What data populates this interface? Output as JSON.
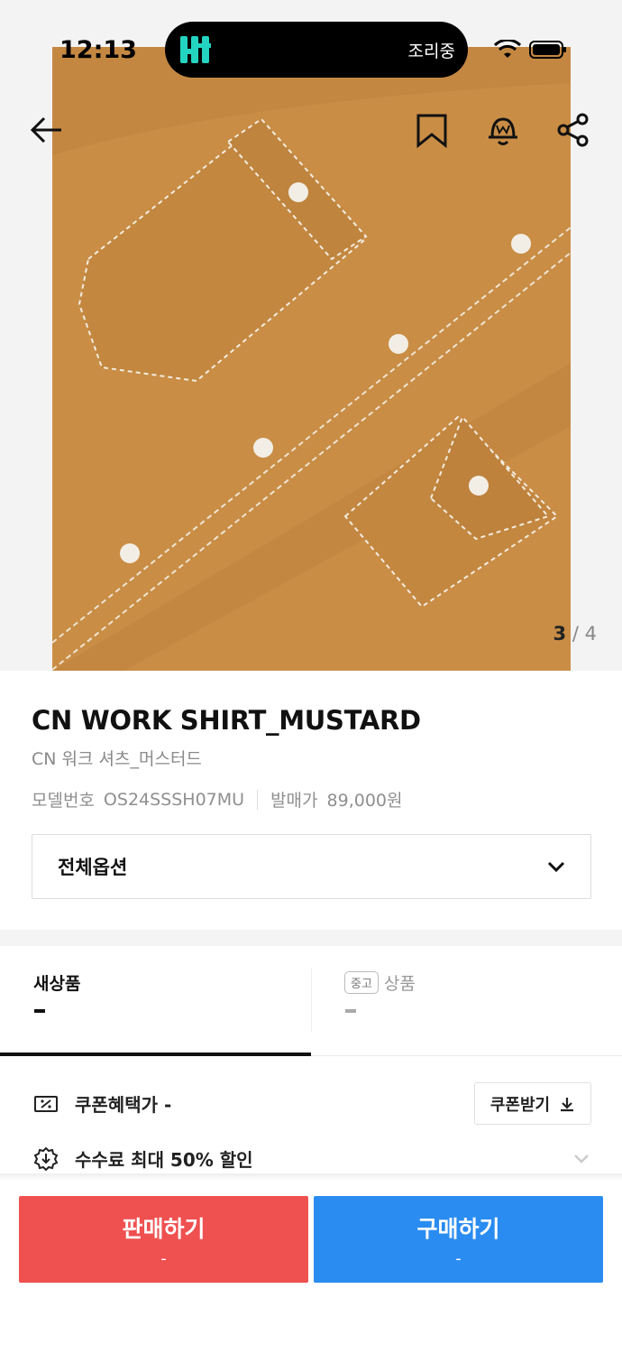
{
  "status_bar": {
    "time": "12:13",
    "dynamic_island_label": "조리중",
    "dynamic_island_logo_color": "#23d4c1"
  },
  "gallery": {
    "current_page": "3",
    "separator": "/",
    "total_pages": "4",
    "background_color": "#c98d45"
  },
  "nav": {
    "icons": [
      "back-arrow-icon",
      "bookmark-icon",
      "alarm-bell-icon",
      "share-icon"
    ]
  },
  "product": {
    "title": "CN WORK SHIRT_MUSTARD",
    "subtitle": "CN 워크 셔츠_머스터드",
    "model_label": "모델번호",
    "model_value": "OS24SSSH07MU",
    "release_label": "발매가",
    "release_value": "89,000원"
  },
  "options": {
    "selected": "전체옵션"
  },
  "tabs": {
    "new": {
      "label": "새상품",
      "price": "-"
    },
    "used": {
      "badge": "중고",
      "label": "상품",
      "price": "-"
    }
  },
  "benefits": {
    "coupon_label": "쿠폰혜택가 -",
    "coupon_button": "쿠폰받기",
    "fee_label": "수수료 최대 50% 할인"
  },
  "actions": {
    "sell_label": "판매하기",
    "sell_price": "-",
    "sell_color": "#ef5050",
    "buy_label": "구매하기",
    "buy_price": "-",
    "buy_color": "#2a8cf0"
  }
}
